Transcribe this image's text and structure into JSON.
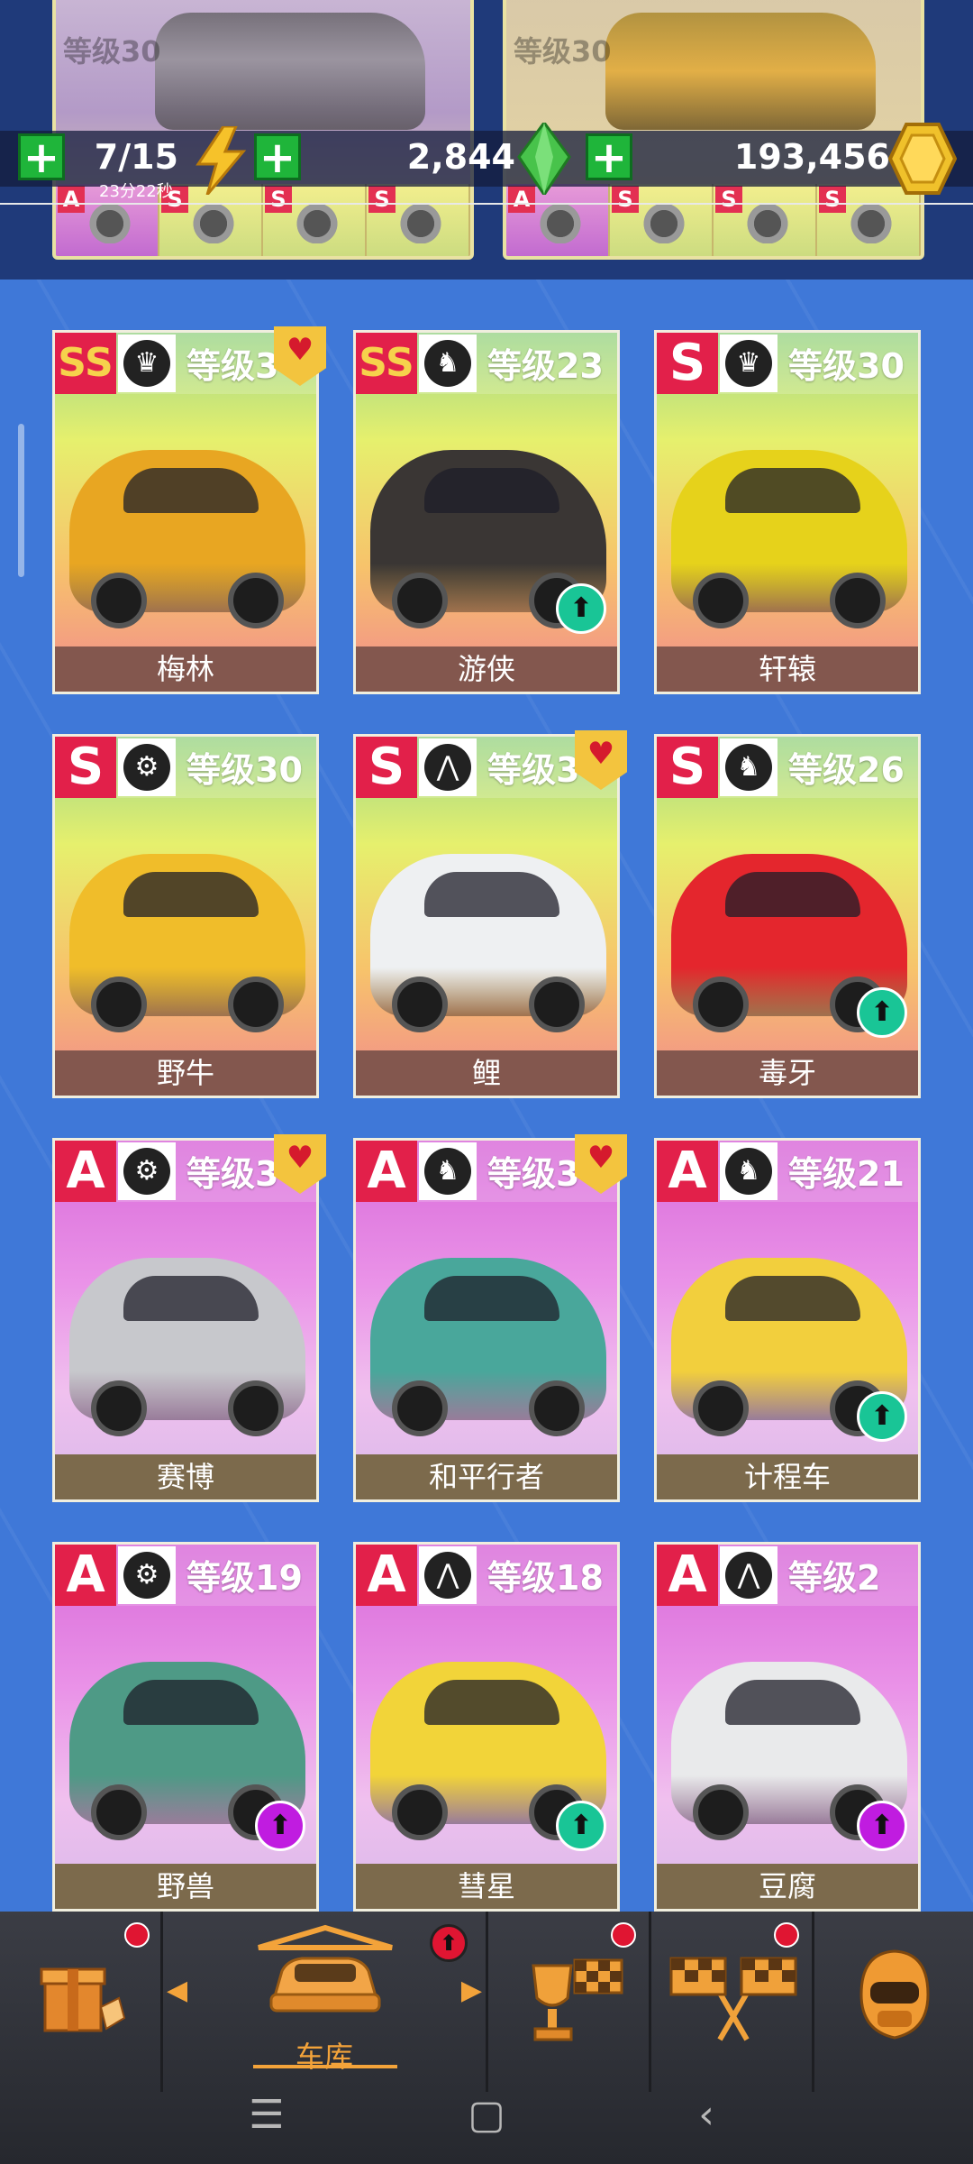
{
  "top_strip": {
    "card1_level": "等级30",
    "card2_level": "等级30",
    "card1_parts": [
      {
        "tag": "A",
        "icon": "turbo-icon",
        "style": "a"
      },
      {
        "tag": "S",
        "icon": "engine-icon",
        "style": "s"
      },
      {
        "tag": "S",
        "icon": "suspension-icon",
        "style": "s"
      },
      {
        "tag": "S",
        "icon": "tire-icon",
        "style": "s"
      }
    ],
    "card2_parts": [
      {
        "tag": "A",
        "icon": "turbo-icon",
        "style": "a"
      },
      {
        "tag": "S",
        "icon": "engine-icon",
        "style": "s"
      },
      {
        "tag": "S",
        "icon": "suspension-icon",
        "style": "s"
      },
      {
        "tag": "S",
        "icon": "tire-icon",
        "style": "s"
      }
    ]
  },
  "resources": {
    "energy": {
      "value": "7/15",
      "timer": "23分22秒",
      "icon": "lightning-icon"
    },
    "gems": {
      "value": "2,844",
      "icon": "green-gem-icon"
    },
    "coins": {
      "value": "193,456",
      "icon": "gold-coin-icon"
    }
  },
  "cars": [
    {
      "grade": "SS",
      "class_icon": "crown-icon",
      "level": "等级3",
      "name": "梅林",
      "favorite": true,
      "upgrade": "none",
      "car_color": "#e8a622",
      "rarity": "S"
    },
    {
      "grade": "SS",
      "class_icon": "horse-icon",
      "level": "等级23",
      "name": "游侠",
      "favorite": false,
      "upgrade": "green",
      "car_color": "#3a3634",
      "rarity": "S"
    },
    {
      "grade": "S",
      "class_icon": "crown-icon",
      "level": "等级30",
      "name": "轩辕",
      "favorite": false,
      "upgrade": "none",
      "car_color": "#e6d21b",
      "rarity": "S"
    },
    {
      "grade": "S",
      "class_icon": "wheel-icon",
      "level": "等级30",
      "name": "野牛",
      "favorite": false,
      "upgrade": "none",
      "car_color": "#f0bd2a",
      "rarity": "S"
    },
    {
      "grade": "S",
      "class_icon": "road-icon",
      "level": "等级3",
      "name": "鲤",
      "favorite": true,
      "upgrade": "none",
      "car_color": "#eef0f2",
      "rarity": "S"
    },
    {
      "grade": "S",
      "class_icon": "horse-icon",
      "level": "等级26",
      "name": "毒牙",
      "favorite": false,
      "upgrade": "green",
      "car_color": "#e4262d",
      "rarity": "S"
    },
    {
      "grade": "A",
      "class_icon": "wheel-icon",
      "level": "等级3",
      "name": "赛博",
      "favorite": true,
      "upgrade": "none",
      "car_color": "#c7c8cc",
      "rarity": "A"
    },
    {
      "grade": "A",
      "class_icon": "horse-icon",
      "level": "等级3",
      "name": "和平行者",
      "favorite": true,
      "upgrade": "none",
      "car_color": "#49a79b",
      "rarity": "A"
    },
    {
      "grade": "A",
      "class_icon": "horse-icon",
      "level": "等级21",
      "name": "计程车",
      "favorite": false,
      "upgrade": "green",
      "car_color": "#f2cf3d",
      "rarity": "A"
    },
    {
      "grade": "A",
      "class_icon": "wheel-icon",
      "level": "等级19",
      "name": "野兽",
      "favorite": false,
      "upgrade": "purple",
      "car_color": "#4e9a86",
      "rarity": "A"
    },
    {
      "grade": "A",
      "class_icon": "road-icon",
      "level": "等级18",
      "name": "彗星",
      "favorite": false,
      "upgrade": "green",
      "car_color": "#f2d439",
      "rarity": "A"
    },
    {
      "grade": "A",
      "class_icon": "road-icon",
      "level": "等级2",
      "name": "豆腐",
      "favorite": false,
      "upgrade": "purple",
      "car_color": "#e9eaeb",
      "rarity": "A"
    }
  ],
  "nav": {
    "shop_icon": "shop-box-icon",
    "garage_label": "车库",
    "garage_icon": "garage-car-icon",
    "trophy_icon": "trophy-flag-icon",
    "race_icon": "checkered-flags-icon",
    "profile_icon": "helmet-icon"
  },
  "system": {
    "menu": "☰",
    "home": "▢",
    "back": "‹"
  },
  "colors": {
    "background": "#3f78d8",
    "accent": "#f3a33a",
    "grade_red": "#e2204a",
    "upgrade_green": "#19c596",
    "upgrade_purple": "#c01ce0"
  }
}
